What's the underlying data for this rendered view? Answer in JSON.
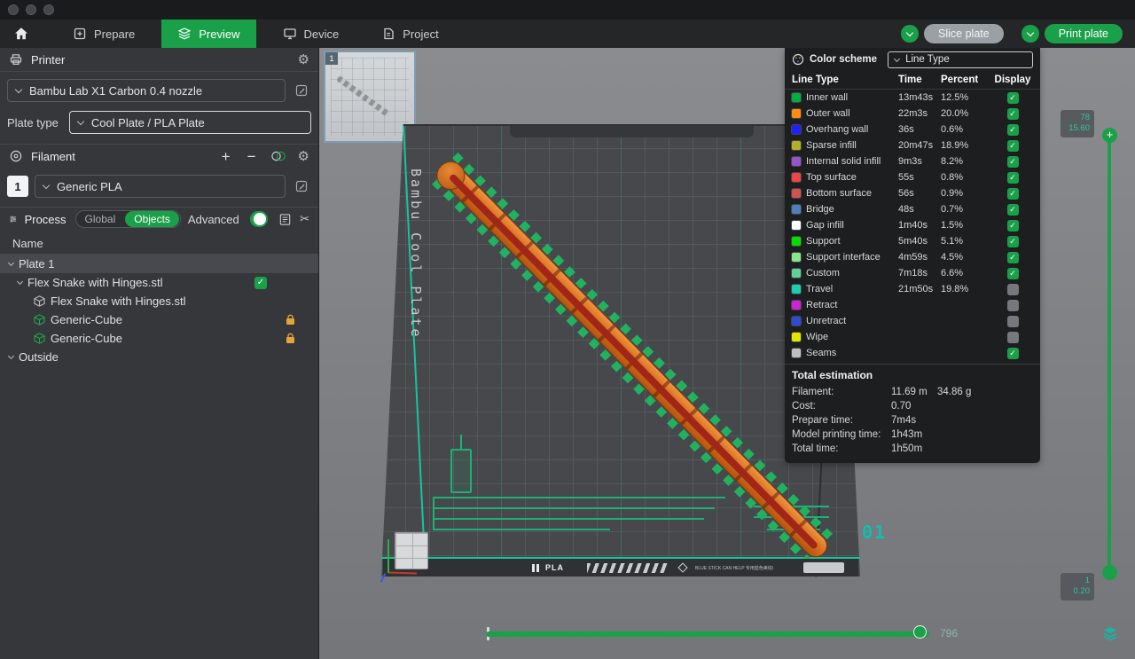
{
  "window": {
    "buttons": [
      "close",
      "minimize",
      "zoom"
    ]
  },
  "nav": {
    "tabs": [
      {
        "label": "Prepare",
        "icon": "prepare-icon",
        "active": false
      },
      {
        "label": "Preview",
        "icon": "preview-icon",
        "active": true
      },
      {
        "label": "Device",
        "icon": "device-icon",
        "active": false
      },
      {
        "label": "Project",
        "icon": "project-icon",
        "active": false
      }
    ],
    "slice_button": "Slice plate",
    "print_button": "Print plate",
    "accent_green": "#1BA04A"
  },
  "sidebar": {
    "printer": {
      "title": "Printer",
      "preset": "Bambu Lab X1 Carbon 0.4 nozzle",
      "plate_type_label": "Plate type",
      "plate_type_value": "Cool Plate / PLA Plate"
    },
    "filament": {
      "title": "Filament",
      "index": "1",
      "preset": "Generic PLA"
    },
    "process": {
      "title": "Process",
      "toggle_global": "Global",
      "toggle_objects": "Objects",
      "advanced_label": "Advanced"
    },
    "objects": {
      "header": "Name",
      "rows": [
        {
          "label": "Plate 1",
          "type": "plate",
          "indent": 0,
          "chevron": true,
          "selected": true
        },
        {
          "label": "Flex Snake with Hinges.stl",
          "type": "object",
          "indent": 1,
          "chevron": true,
          "checkbox": true
        },
        {
          "label": "Flex Snake with Hinges.stl",
          "type": "part",
          "indent": 2
        },
        {
          "label": "Generic-Cube",
          "type": "cube",
          "indent": 2,
          "locked": true
        },
        {
          "label": "Generic-Cube",
          "type": "cube",
          "indent": 2,
          "locked": true
        },
        {
          "label": "Outside",
          "type": "group",
          "indent": 0,
          "chevron": true
        }
      ]
    }
  },
  "viewport": {
    "thumbnail_label": "1",
    "plate_name_vertical": "Bambu Cool Plate",
    "plate_number": "01",
    "plate_strip_label": "PLA",
    "plate_strip_note": "BLUE STICK CAN HELP 专用蓝色美纹纸胶带辅助",
    "h_slider_value": "796",
    "v_slider_top_layer": "78",
    "v_slider_top_height": "15.60",
    "v_slider_bottom_layer": "1",
    "v_slider_bottom_height": "0.20"
  },
  "legend": {
    "title": "Color scheme",
    "dropdown_value": "Line Type",
    "columns": [
      "Line Type",
      "Time",
      "Percent",
      "Display"
    ],
    "rows": [
      {
        "label": "Inner wall",
        "color": "#00AE42",
        "time": "13m43s",
        "percent": "12.5%",
        "checked": true
      },
      {
        "label": "Outer wall",
        "color": "#FF8C0F",
        "time": "22m3s",
        "percent": "20.0%",
        "checked": true
      },
      {
        "label": "Overhang wall",
        "color": "#2020FF",
        "time": "36s",
        "percent": "0.6%",
        "checked": true
      },
      {
        "label": "Sparse infill",
        "color": "#B0B029",
        "time": "20m47s",
        "percent": "18.9%",
        "checked": true
      },
      {
        "label": "Internal solid infill",
        "color": "#9654CC",
        "time": "9m3s",
        "percent": "8.2%",
        "checked": true
      },
      {
        "label": "Top surface",
        "color": "#F04545",
        "time": "55s",
        "percent": "0.8%",
        "checked": true
      },
      {
        "label": "Bottom surface",
        "color": "#D25252",
        "time": "56s",
        "percent": "0.9%",
        "checked": true
      },
      {
        "label": "Bridge",
        "color": "#4D80BA",
        "time": "48s",
        "percent": "0.7%",
        "checked": true
      },
      {
        "label": "Gap infill",
        "color": "#FFFFFF",
        "time": "1m40s",
        "percent": "1.5%",
        "checked": true
      },
      {
        "label": "Support",
        "color": "#00E000",
        "time": "5m40s",
        "percent": "5.1%",
        "checked": true
      },
      {
        "label": "Support interface",
        "color": "#88E788",
        "time": "4m59s",
        "percent": "4.5%",
        "checked": true
      },
      {
        "label": "Custom",
        "color": "#5ED194",
        "time": "7m18s",
        "percent": "6.6%",
        "checked": true
      },
      {
        "label": "Travel",
        "color": "#1ECCB0",
        "time": "21m50s",
        "percent": "19.8%",
        "checked": false
      },
      {
        "label": "Retract",
        "color": "#CD22D6",
        "time": "",
        "percent": "",
        "checked": false
      },
      {
        "label": "Unretract",
        "color": "#2E4BD2",
        "time": "",
        "percent": "",
        "checked": false
      },
      {
        "label": "Wipe",
        "color": "#E6E600",
        "time": "",
        "percent": "",
        "checked": false
      },
      {
        "label": "Seams",
        "color": "#BFBFBF",
        "time": "",
        "percent": "",
        "checked": true
      }
    ],
    "total_title": "Total estimation",
    "totals": [
      {
        "label": "Filament:",
        "value": "11.69 m",
        "extra": "34.86 g"
      },
      {
        "label": "Cost:",
        "value": "0.70",
        "extra": ""
      },
      {
        "label": "Prepare time:",
        "value": "7m4s",
        "extra": ""
      },
      {
        "label": "Model printing time:",
        "value": "1h43m",
        "extra": ""
      },
      {
        "label": "Total time:",
        "value": "1h50m",
        "extra": ""
      }
    ]
  }
}
